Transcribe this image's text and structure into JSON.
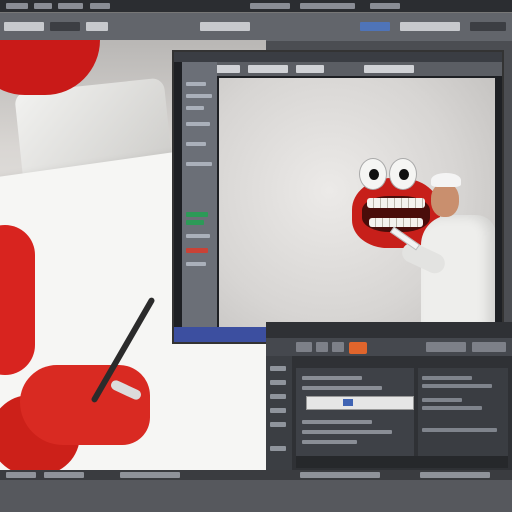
{
  "scene": {
    "description_hint": "",
    "windows": [
      "menubar",
      "toolbar",
      "photo",
      "editor",
      "panel",
      "taskbar"
    ]
  },
  "colors": {
    "accent_blue": "#3c4fa0",
    "accent_orange": "#e0652c",
    "monster_red": "#c71f1a",
    "status_green": "#2c9a57"
  },
  "icons": [
    "app-menu-icon",
    "toolbar-tool-icon",
    "render-button-icon",
    "slider-knob-icon"
  ]
}
